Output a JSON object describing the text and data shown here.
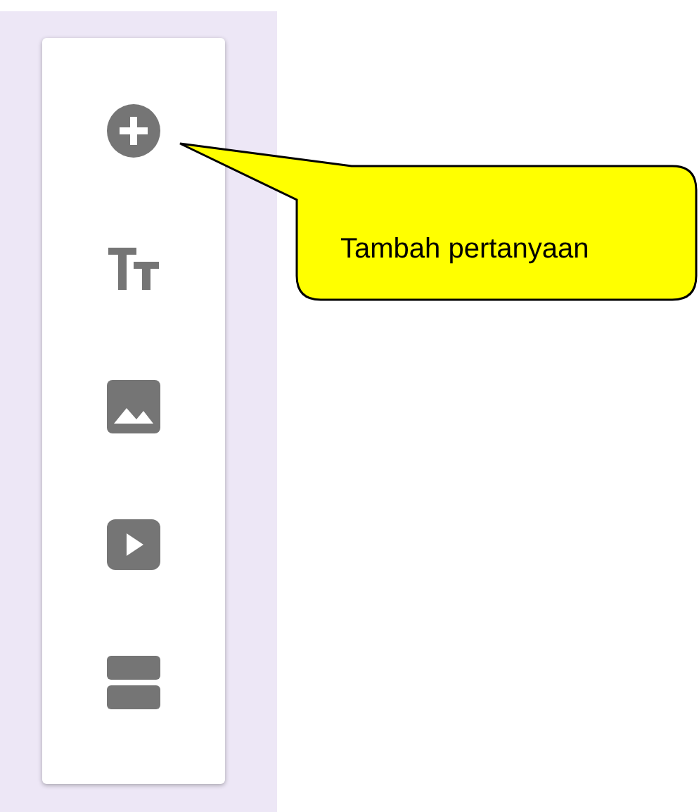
{
  "callout": {
    "text": "Tambah pertanyaan"
  }
}
